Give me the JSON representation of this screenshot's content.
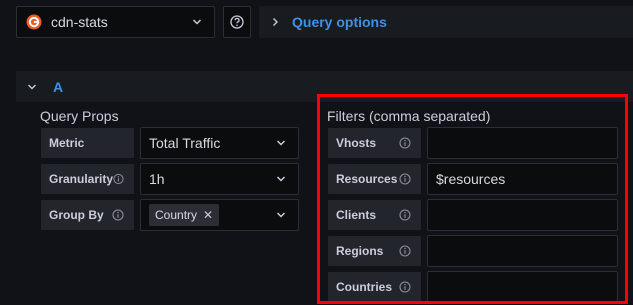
{
  "datasource": {
    "name": "cdn-stats",
    "logo_icon": "grafana-logo-icon"
  },
  "help": {
    "icon": "question-circle-icon"
  },
  "query_options": {
    "label": "Query options"
  },
  "query_row": {
    "ref_id": "A"
  },
  "query_props": {
    "title": "Query Props",
    "metric": {
      "label": "Metric",
      "value": "Total Traffic"
    },
    "granularity": {
      "label": "Granularity",
      "value": "1h"
    },
    "group_by": {
      "label": "Group By",
      "tags": [
        "Country"
      ]
    }
  },
  "filters": {
    "title": "Filters (comma separated)",
    "vhosts": {
      "label": "Vhosts",
      "value": ""
    },
    "resources": {
      "label": "Resources",
      "value": "$resources"
    },
    "clients": {
      "label": "Clients",
      "value": ""
    },
    "regions": {
      "label": "Regions",
      "value": ""
    },
    "countries": {
      "label": "Countries",
      "value": ""
    }
  },
  "colors": {
    "accent": "#3d91e6",
    "highlight": "#ff0000",
    "background": "#111217"
  }
}
